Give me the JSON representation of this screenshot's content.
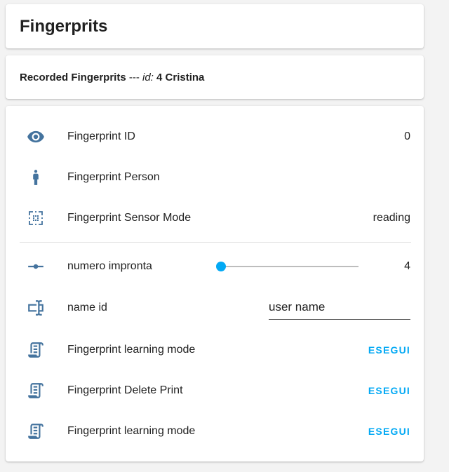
{
  "title_card": {
    "title": "Fingerprits"
  },
  "markdown_card": {
    "strong_text": "Recorded Fingerprits",
    "separator": " --- ",
    "id_label": "id:",
    "id_value": " 4 Cristina"
  },
  "entities": {
    "fingerprint_id": {
      "label": "Fingerprint ID",
      "value": "0",
      "icon": "eye-icon"
    },
    "fingerprint_person": {
      "label": "Fingerprint Person",
      "value": "",
      "icon": "person-icon"
    },
    "sensor_mode": {
      "label": "Fingerprint Sensor Mode",
      "value": "reading",
      "icon": "scan-icon"
    },
    "numero_impronta": {
      "label": "numero impronta",
      "value": "4",
      "slider_fraction": 0.0,
      "icon": "ray-vertex-icon"
    },
    "name_id": {
      "label": "name id",
      "input_value": "user name",
      "icon": "form-textbox-icon"
    },
    "scripts": [
      {
        "label": "Fingerprint learning mode",
        "button": "ESEGUI",
        "icon": "script-text-icon"
      },
      {
        "label": "Fingerprint Delete Print",
        "button": "ESEGUI",
        "icon": "script-text-icon"
      },
      {
        "label": "Fingerprint learning mode",
        "button": "ESEGUI",
        "icon": "script-text-icon"
      }
    ]
  },
  "colors": {
    "icon": "#44739e",
    "accent": "#03a9f4",
    "background": "#f3f3f3"
  }
}
